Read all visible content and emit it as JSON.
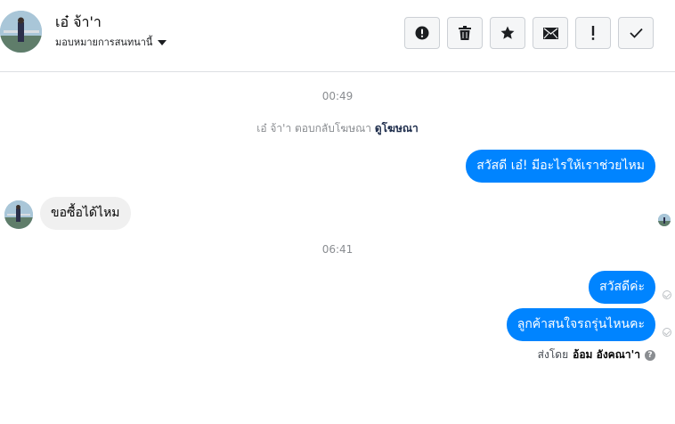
{
  "header": {
    "contact_name": "เอ๋ จ้า'า",
    "assign_label": "มอบหมายการสนทนานี้",
    "actions": [
      {
        "name": "spam-button",
        "icon": "exclamation-circle-icon"
      },
      {
        "name": "delete-button",
        "icon": "trash-icon"
      },
      {
        "name": "star-button",
        "icon": "star-icon"
      },
      {
        "name": "mark-unread-button",
        "icon": "envelope-icon"
      },
      {
        "name": "follow-up-button",
        "icon": "exclamation-icon"
      },
      {
        "name": "mark-done-button",
        "icon": "check-icon"
      }
    ]
  },
  "conversation": {
    "timestamp_1": "00:49",
    "ad_reply": {
      "prefix": "เอ๋ จ้า'า ตอบกลับโฆษณา",
      "link": "ดูโฆษณา"
    },
    "msg_greeting": "สวัสดี เอ๋! มีอะไรให้เราช่วยไหม",
    "msg_customer": "ขอซื้อได้ไหม",
    "timestamp_2": "06:41",
    "msg_hello": "สวัสดีค่ะ",
    "msg_question": "ลูกค้าสนใจรถรุ่นไหนคะ",
    "sent_by_prefix": "ส่งโดย",
    "sent_by_name": "อ้อม อังคณา'า"
  },
  "colors": {
    "outgoing_bubble": "#0084ff",
    "incoming_bubble": "#f0f0f0",
    "timestamp_text": "#8a8d91"
  }
}
